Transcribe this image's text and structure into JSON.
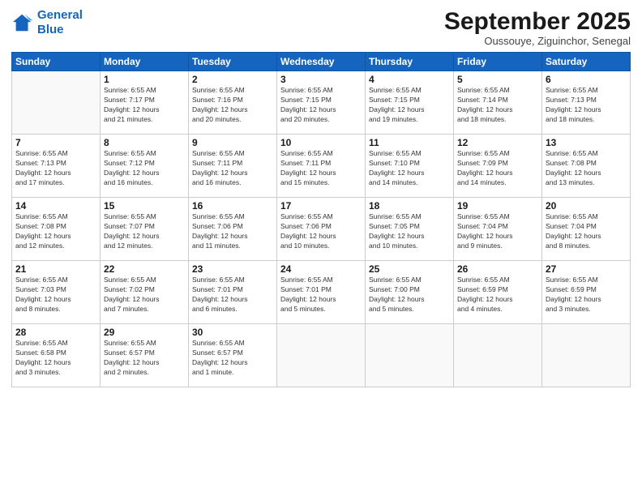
{
  "logo": {
    "line1": "General",
    "line2": "Blue"
  },
  "title": "September 2025",
  "subtitle": "Oussouye, Ziguinchor, Senegal",
  "weekdays": [
    "Sunday",
    "Monday",
    "Tuesday",
    "Wednesday",
    "Thursday",
    "Friday",
    "Saturday"
  ],
  "weeks": [
    [
      {
        "day": "",
        "info": ""
      },
      {
        "day": "1",
        "info": "Sunrise: 6:55 AM\nSunset: 7:17 PM\nDaylight: 12 hours\nand 21 minutes."
      },
      {
        "day": "2",
        "info": "Sunrise: 6:55 AM\nSunset: 7:16 PM\nDaylight: 12 hours\nand 20 minutes."
      },
      {
        "day": "3",
        "info": "Sunrise: 6:55 AM\nSunset: 7:15 PM\nDaylight: 12 hours\nand 20 minutes."
      },
      {
        "day": "4",
        "info": "Sunrise: 6:55 AM\nSunset: 7:15 PM\nDaylight: 12 hours\nand 19 minutes."
      },
      {
        "day": "5",
        "info": "Sunrise: 6:55 AM\nSunset: 7:14 PM\nDaylight: 12 hours\nand 18 minutes."
      },
      {
        "day": "6",
        "info": "Sunrise: 6:55 AM\nSunset: 7:13 PM\nDaylight: 12 hours\nand 18 minutes."
      }
    ],
    [
      {
        "day": "7",
        "info": "Sunrise: 6:55 AM\nSunset: 7:13 PM\nDaylight: 12 hours\nand 17 minutes."
      },
      {
        "day": "8",
        "info": "Sunrise: 6:55 AM\nSunset: 7:12 PM\nDaylight: 12 hours\nand 16 minutes."
      },
      {
        "day": "9",
        "info": "Sunrise: 6:55 AM\nSunset: 7:11 PM\nDaylight: 12 hours\nand 16 minutes."
      },
      {
        "day": "10",
        "info": "Sunrise: 6:55 AM\nSunset: 7:11 PM\nDaylight: 12 hours\nand 15 minutes."
      },
      {
        "day": "11",
        "info": "Sunrise: 6:55 AM\nSunset: 7:10 PM\nDaylight: 12 hours\nand 14 minutes."
      },
      {
        "day": "12",
        "info": "Sunrise: 6:55 AM\nSunset: 7:09 PM\nDaylight: 12 hours\nand 14 minutes."
      },
      {
        "day": "13",
        "info": "Sunrise: 6:55 AM\nSunset: 7:08 PM\nDaylight: 12 hours\nand 13 minutes."
      }
    ],
    [
      {
        "day": "14",
        "info": "Sunrise: 6:55 AM\nSunset: 7:08 PM\nDaylight: 12 hours\nand 12 minutes."
      },
      {
        "day": "15",
        "info": "Sunrise: 6:55 AM\nSunset: 7:07 PM\nDaylight: 12 hours\nand 12 minutes."
      },
      {
        "day": "16",
        "info": "Sunrise: 6:55 AM\nSunset: 7:06 PM\nDaylight: 12 hours\nand 11 minutes."
      },
      {
        "day": "17",
        "info": "Sunrise: 6:55 AM\nSunset: 7:06 PM\nDaylight: 12 hours\nand 10 minutes."
      },
      {
        "day": "18",
        "info": "Sunrise: 6:55 AM\nSunset: 7:05 PM\nDaylight: 12 hours\nand 10 minutes."
      },
      {
        "day": "19",
        "info": "Sunrise: 6:55 AM\nSunset: 7:04 PM\nDaylight: 12 hours\nand 9 minutes."
      },
      {
        "day": "20",
        "info": "Sunrise: 6:55 AM\nSunset: 7:04 PM\nDaylight: 12 hours\nand 8 minutes."
      }
    ],
    [
      {
        "day": "21",
        "info": "Sunrise: 6:55 AM\nSunset: 7:03 PM\nDaylight: 12 hours\nand 8 minutes."
      },
      {
        "day": "22",
        "info": "Sunrise: 6:55 AM\nSunset: 7:02 PM\nDaylight: 12 hours\nand 7 minutes."
      },
      {
        "day": "23",
        "info": "Sunrise: 6:55 AM\nSunset: 7:01 PM\nDaylight: 12 hours\nand 6 minutes."
      },
      {
        "day": "24",
        "info": "Sunrise: 6:55 AM\nSunset: 7:01 PM\nDaylight: 12 hours\nand 5 minutes."
      },
      {
        "day": "25",
        "info": "Sunrise: 6:55 AM\nSunset: 7:00 PM\nDaylight: 12 hours\nand 5 minutes."
      },
      {
        "day": "26",
        "info": "Sunrise: 6:55 AM\nSunset: 6:59 PM\nDaylight: 12 hours\nand 4 minutes."
      },
      {
        "day": "27",
        "info": "Sunrise: 6:55 AM\nSunset: 6:59 PM\nDaylight: 12 hours\nand 3 minutes."
      }
    ],
    [
      {
        "day": "28",
        "info": "Sunrise: 6:55 AM\nSunset: 6:58 PM\nDaylight: 12 hours\nand 3 minutes."
      },
      {
        "day": "29",
        "info": "Sunrise: 6:55 AM\nSunset: 6:57 PM\nDaylight: 12 hours\nand 2 minutes."
      },
      {
        "day": "30",
        "info": "Sunrise: 6:55 AM\nSunset: 6:57 PM\nDaylight: 12 hours\nand 1 minute."
      },
      {
        "day": "",
        "info": ""
      },
      {
        "day": "",
        "info": ""
      },
      {
        "day": "",
        "info": ""
      },
      {
        "day": "",
        "info": ""
      }
    ]
  ]
}
